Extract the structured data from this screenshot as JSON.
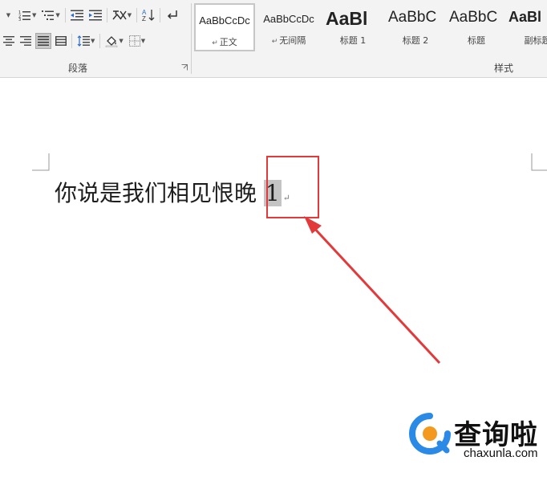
{
  "ribbon": {
    "paragraph_group": {
      "label": "段落",
      "buttons_row1": [
        {
          "name": "bullets-icon"
        },
        {
          "name": "numbering-icon"
        },
        {
          "name": "multilevel-list-icon"
        },
        {
          "name": "decrease-indent-icon"
        },
        {
          "name": "increase-indent-icon"
        },
        {
          "name": "chinese-layout-icon"
        },
        {
          "name": "sort-icon",
          "text": "A↓"
        },
        {
          "name": "show-marks-icon"
        }
      ],
      "buttons_row2": [
        {
          "name": "align-center-icon"
        },
        {
          "name": "align-right-icon"
        },
        {
          "name": "justify-icon",
          "active": true
        },
        {
          "name": "distributed-icon"
        },
        {
          "name": "line-spacing-icon"
        },
        {
          "name": "shading-icon"
        },
        {
          "name": "borders-icon"
        }
      ]
    },
    "styles_group": {
      "label": "样式",
      "items": [
        {
          "preview": "AaBbCcDc",
          "name": "正文",
          "mark": "↵",
          "selected": true,
          "size": "small"
        },
        {
          "preview": "AaBbCcDc",
          "name": "无间隔",
          "mark": "↵",
          "selected": false,
          "size": "small"
        },
        {
          "preview": "AaBl",
          "name": "标题 1",
          "mark": "",
          "selected": false,
          "size": "large"
        },
        {
          "preview": "AaBbC",
          "name": "标题 2",
          "mark": "",
          "selected": false,
          "size": "medium"
        },
        {
          "preview": "AaBbC",
          "name": "标题",
          "mark": "",
          "selected": false,
          "size": "medium"
        },
        {
          "preview": "AaBl",
          "name": "副标题",
          "mark": "",
          "selected": false,
          "size": "medium-bold"
        }
      ]
    }
  },
  "document": {
    "text": "你说是我们相见恨晚",
    "selected_text": "1",
    "paragraph_mark": "↵"
  },
  "watermark": {
    "title": "查询啦",
    "url": "chaxunla.com"
  },
  "colors": {
    "annotation": "#e23a3a",
    "selection": "#c4c4c4",
    "ribbon_bg": "#f3f3f3",
    "logo_blue": "#2a8ae6",
    "logo_orange": "#f39a1e"
  }
}
